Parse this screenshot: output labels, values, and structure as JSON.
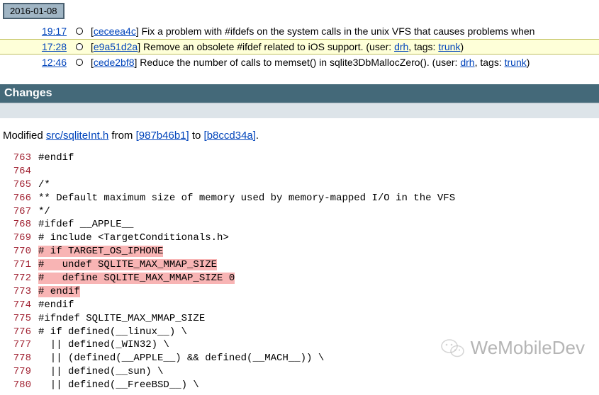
{
  "date_header": "2016-01-08",
  "timeline": [
    {
      "time": "19:17",
      "hash": "ceceea4c",
      "desc": "Fix a problem with #ifdefs on the system calls in the unix VFS that causes problems when",
      "highlighted": false,
      "graph": "down"
    },
    {
      "time": "17:28",
      "hash": "e9a51d2a",
      "desc_prefix": "Remove an obsolete #ifdef related to iOS support. (user: ",
      "user": "drh",
      "desc_mid": ", tags: ",
      "tag": "trunk",
      "desc_suffix": ")",
      "highlighted": true,
      "graph": "full"
    },
    {
      "time": "12:46",
      "hash": "cede2bf8",
      "desc_prefix": "Reduce the number of calls to memset() in sqlite3DbMallocZero(). (user: ",
      "user": "drh",
      "desc_mid": ", tags: ",
      "tag": "trunk",
      "desc_suffix": ")",
      "highlighted": false,
      "graph": "up"
    }
  ],
  "changes_header": "Changes",
  "modified": {
    "prefix": "Modified ",
    "file": "src/sqliteInt.h",
    "from_text": " from ",
    "from_hash": "[987b46b1]",
    "to_text": " to ",
    "to_hash": "[b8ccd34a]",
    "suffix": "."
  },
  "code": [
    {
      "n": "763",
      "t": "#endif",
      "removed": false
    },
    {
      "n": "764",
      "t": "",
      "removed": false
    },
    {
      "n": "765",
      "t": "/*",
      "removed": false
    },
    {
      "n": "766",
      "t": "** Default maximum size of memory used by memory-mapped I/O in the VFS",
      "removed": false
    },
    {
      "n": "767",
      "t": "*/",
      "removed": false
    },
    {
      "n": "768",
      "t": "#ifdef __APPLE__",
      "removed": false
    },
    {
      "n": "769",
      "t": "# include <TargetConditionals.h>",
      "removed": false
    },
    {
      "n": "770",
      "t": "# if TARGET_OS_IPHONE",
      "removed": true
    },
    {
      "n": "771",
      "t": "#   undef SQLITE_MAX_MMAP_SIZE",
      "removed": true
    },
    {
      "n": "772",
      "t": "#   define SQLITE_MAX_MMAP_SIZE 0",
      "removed": true
    },
    {
      "n": "773",
      "t": "# endif",
      "removed": true
    },
    {
      "n": "774",
      "t": "#endif",
      "removed": false
    },
    {
      "n": "775",
      "t": "#ifndef SQLITE_MAX_MMAP_SIZE",
      "removed": false
    },
    {
      "n": "776",
      "t": "# if defined(__linux__) \\",
      "removed": false
    },
    {
      "n": "777",
      "t": "  || defined(_WIN32) \\",
      "removed": false
    },
    {
      "n": "778",
      "t": "  || (defined(__APPLE__) && defined(__MACH__)) \\",
      "removed": false
    },
    {
      "n": "779",
      "t": "  || defined(__sun) \\",
      "removed": false
    },
    {
      "n": "780",
      "t": "  || defined(__FreeBSD__) \\",
      "removed": false
    }
  ],
  "watermark": "WeMobileDev"
}
